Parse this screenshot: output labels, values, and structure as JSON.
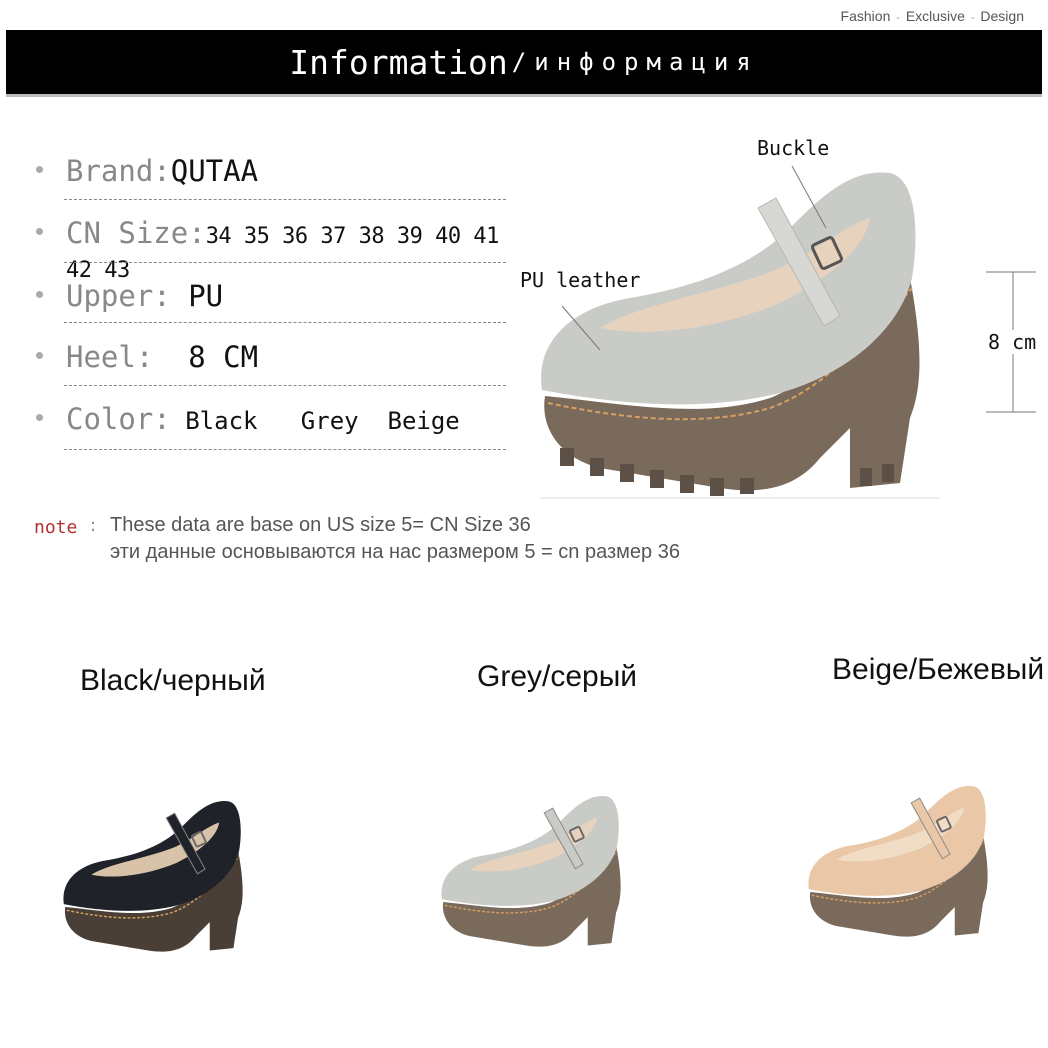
{
  "tagline": {
    "a": "Fashion",
    "b": "Exclusive",
    "c": "Design",
    "sep": "-"
  },
  "banner": {
    "title": "Information",
    "subtitle": "/информация"
  },
  "specs": [
    {
      "label": "Brand:",
      "value": "QUTAA"
    },
    {
      "label": "CN Size:",
      "value": "34 35 36 37 38 39 40 41 42 43"
    },
    {
      "label": "Upper: ",
      "value": "PU"
    },
    {
      "label": "Heel: ",
      "value": " 8 CM"
    },
    {
      "label": "Color:",
      "value": " Black   Grey  Beige"
    }
  ],
  "note": {
    "label": "note",
    "colon": ":",
    "line1": "These data are base on US size 5= CN Size 36",
    "line2": "эти данные основываются на нас размером 5 = cn размер 36"
  },
  "callouts": {
    "buckle": "Buckle",
    "pu_leather": "PU leather",
    "heel_height": "8 cm"
  },
  "colors": [
    {
      "label": "Black/черный",
      "upper": "#1f2329",
      "lining": "#d9c3a8"
    },
    {
      "label": "Grey/серый",
      "upper": "#c9cbc7",
      "lining": "#e6d2bd"
    },
    {
      "label": "Beige/Бежевый",
      "upper": "#e9c7a7",
      "lining": "#f1dcc6"
    }
  ],
  "palette": {
    "sole": "#7a6a5c",
    "sole_dark": "#4a3f37",
    "stitch": "#d8a060",
    "note": "#b43030"
  }
}
